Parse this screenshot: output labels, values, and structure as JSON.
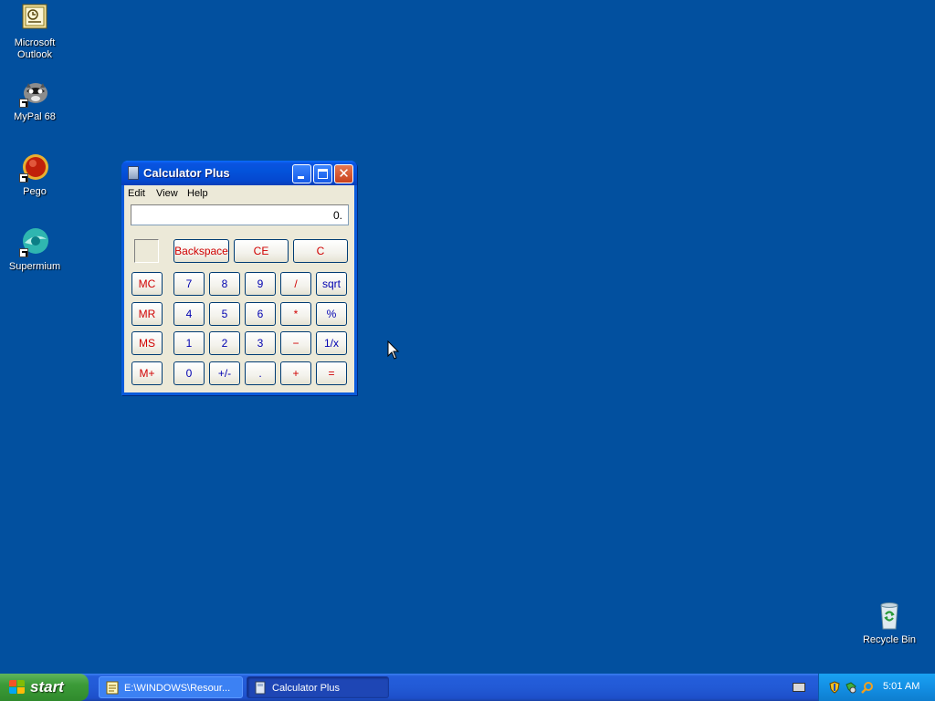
{
  "desktop": {
    "icons": [
      {
        "label_line1": "Microsoft",
        "label_line2": "Outlook",
        "icon": "outlook-icon"
      },
      {
        "label_line1": "MyPal 68",
        "icon": "mypal-icon"
      },
      {
        "label_line1": "Pego",
        "icon": "pego-icon"
      },
      {
        "label_line1": "Supermium",
        "icon": "supermium-icon"
      },
      {
        "label_line1": "Recycle Bin",
        "icon": "recycle-bin-icon"
      }
    ]
  },
  "window": {
    "title": "Calculator Plus",
    "close_glyph": "✕",
    "menu": [
      "Edit",
      "View",
      "Help"
    ],
    "display_value": "0.",
    "buttons": {
      "backspace": "Backspace",
      "ce": "CE",
      "c": "C",
      "mc": "MC",
      "mr": "MR",
      "ms": "MS",
      "mplus": "M+",
      "n7": "7",
      "n8": "8",
      "n9": "9",
      "div": "/",
      "sqrt": "sqrt",
      "n4": "4",
      "n5": "5",
      "n6": "6",
      "mul": "*",
      "pct": "%",
      "n1": "1",
      "n2": "2",
      "n3": "3",
      "sub": "−",
      "inv": "1/x",
      "n0": "0",
      "sign": "+/-",
      "dot": ".",
      "add": "+",
      "eq": "="
    }
  },
  "taskbar": {
    "start_label": "start",
    "tasks": [
      {
        "label": "E:\\WINDOWS\\Resour..."
      },
      {
        "label": "Calculator Plus"
      }
    ],
    "clock": "5:01 AM"
  },
  "colors": {
    "desktop": "#02509f",
    "operator_red": "#d00000",
    "digit_blue": "#0000b0"
  }
}
